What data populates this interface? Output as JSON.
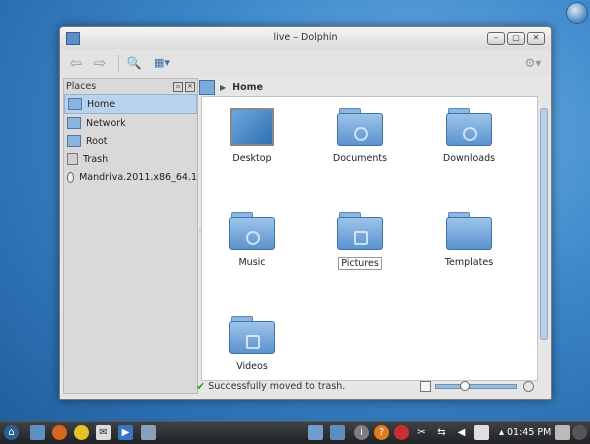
{
  "window": {
    "title": "live – Dolphin"
  },
  "titlebar_buttons": {
    "minimize": "–",
    "maximize": "▢",
    "close": "✕"
  },
  "toolbar": {
    "back_icon": "⇦",
    "forward_icon": "⇨",
    "search_icon": "🔍",
    "view_icon": "▦▾",
    "settings_icon": "⚙▾"
  },
  "places": {
    "header": "Places",
    "items": [
      {
        "label": "Home",
        "icon": "home-folder-icon",
        "selected": true
      },
      {
        "label": "Network",
        "icon": "network-folder-icon"
      },
      {
        "label": "Root",
        "icon": "root-folder-icon"
      },
      {
        "label": "Trash",
        "icon": "trash-icon"
      },
      {
        "label": "Mandriva.2011.x86_64.1",
        "icon": "disk-icon"
      }
    ]
  },
  "breadcrumb": {
    "arrow": "▶",
    "label": "Home"
  },
  "files": [
    {
      "label": "Desktop",
      "icon": "desktop-folder-icon"
    },
    {
      "label": "Documents",
      "icon": "documents-folder-icon"
    },
    {
      "label": "Downloads",
      "icon": "downloads-folder-icon"
    },
    {
      "label": "Music",
      "icon": "music-folder-icon"
    },
    {
      "label": "Pictures",
      "icon": "pictures-folder-icon",
      "selected": true
    },
    {
      "label": "Templates",
      "icon": "templates-folder-icon"
    },
    {
      "label": "Videos",
      "icon": "videos-folder-icon"
    }
  ],
  "status": {
    "message": "Successfully moved to trash.",
    "zoom_fraction": 0.3
  },
  "taskbar": {
    "clock": "01:45 PM"
  },
  "colors": {
    "accent": "#5c93cf",
    "selection": "#b9d2ed",
    "taskbar": "#2a2d30"
  }
}
